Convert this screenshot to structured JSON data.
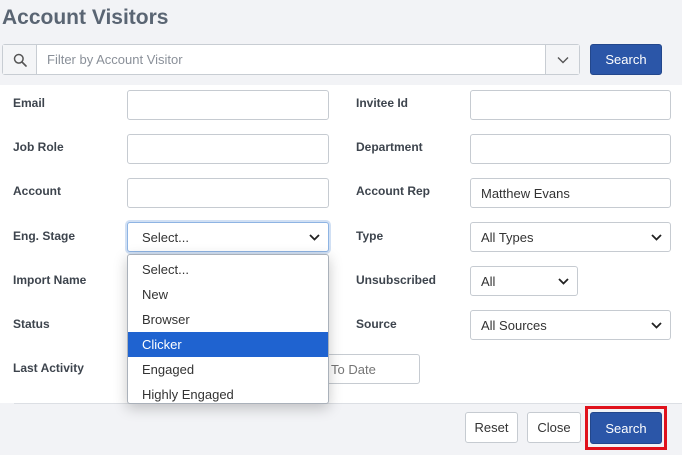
{
  "page": {
    "title": "Account Visitors"
  },
  "filter": {
    "placeholder": "Filter by Account Visitor",
    "search_label": "Search"
  },
  "form": {
    "email_label": "Email",
    "invitee_id_label": "Invitee Id",
    "job_role_label": "Job Role",
    "department_label": "Department",
    "account_label": "Account",
    "account_rep_label": "Account Rep",
    "account_rep_value": "Matthew Evans",
    "eng_stage_label": "Eng. Stage",
    "eng_stage_value": "Select...",
    "type_label": "Type",
    "type_value": "All Types",
    "import_name_label": "Import Name",
    "unsubscribed_label": "Unsubscribed",
    "unsubscribed_value": "All",
    "status_label": "Status",
    "source_label": "Source",
    "source_value": "All Sources",
    "last_activity_label": "Last Activity",
    "to_date_placeholder": "To Date"
  },
  "eng_stage_options": [
    {
      "label": "Select..."
    },
    {
      "label": "New"
    },
    {
      "label": "Browser"
    },
    {
      "label": "Clicker",
      "selected": true
    },
    {
      "label": "Engaged"
    },
    {
      "label": "Highly Engaged"
    }
  ],
  "footer": {
    "reset_label": "Reset",
    "close_label": "Close",
    "search_label": "Search"
  },
  "colors": {
    "primary": "#2b56a8",
    "selected_option": "#1f63d0",
    "highlight": "#e0121c"
  }
}
